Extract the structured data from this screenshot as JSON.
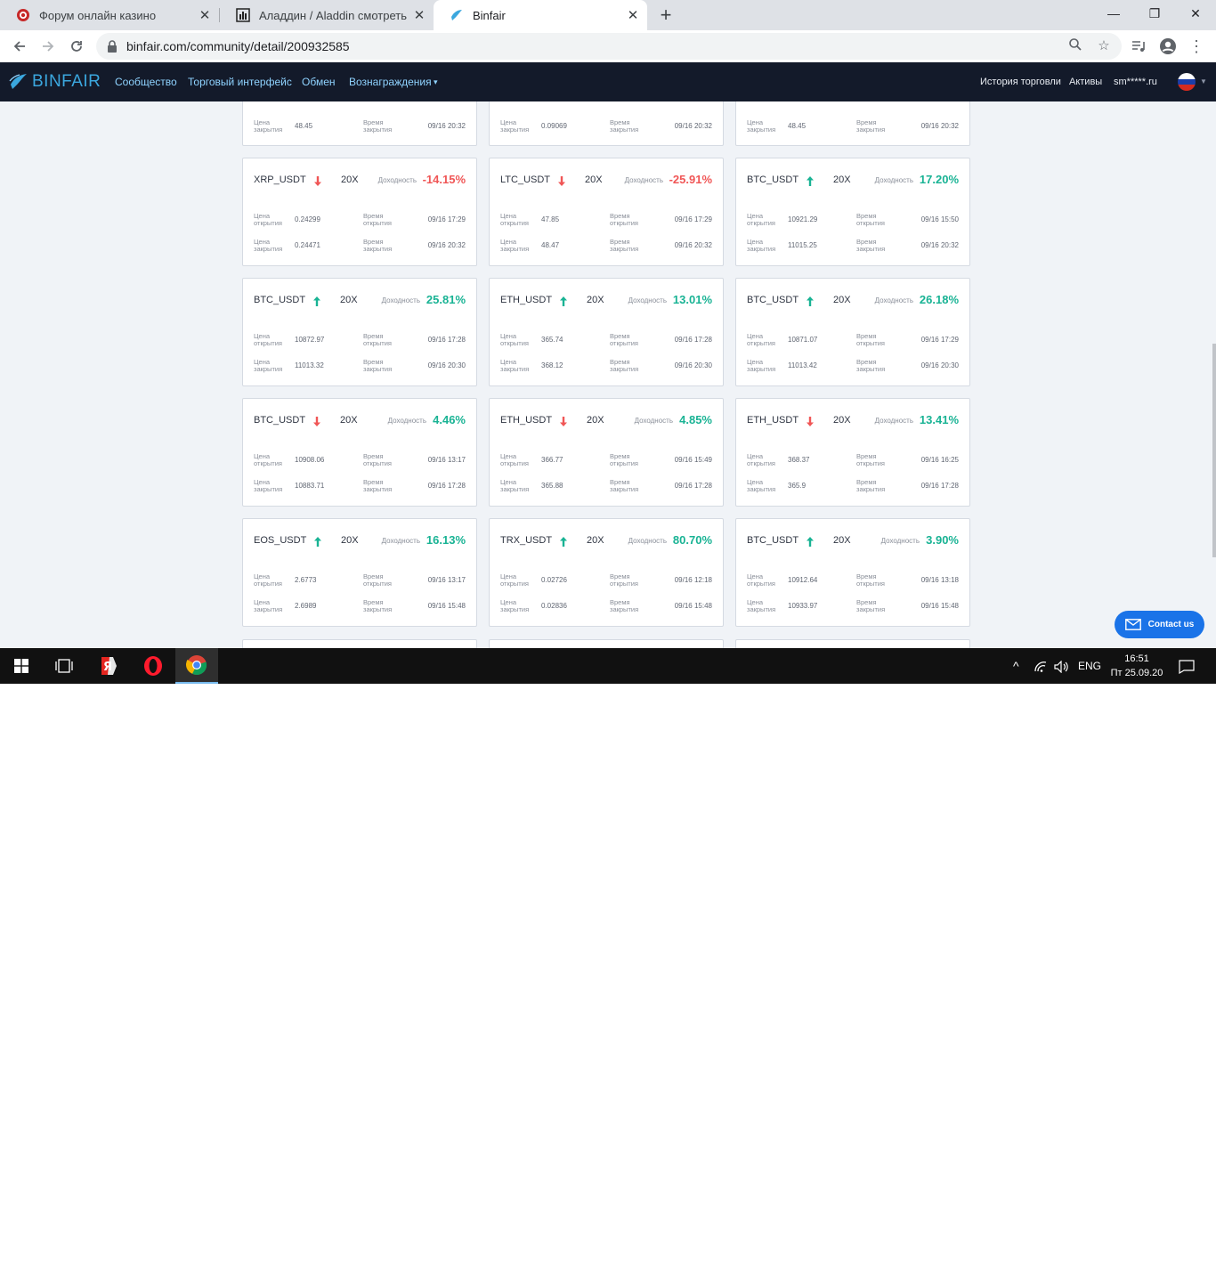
{
  "browser": {
    "tabs": [
      {
        "title": "Форум онлайн казино",
        "active": false,
        "favicon": "poker-chip-icon"
      },
      {
        "title": "Аладдин / Aladdin смотреть онлайн",
        "active": false,
        "favicon": "chart-bars-icon"
      },
      {
        "title": "Binfair",
        "active": true,
        "favicon": "binfair-icon"
      }
    ],
    "url": "binfair.com/community/detail/200932585"
  },
  "site": {
    "logo_text": "BINFAIR",
    "nav": [
      {
        "label": "Сообщество"
      },
      {
        "label": "Торговый интерфейс"
      },
      {
        "label": "Обмен"
      },
      {
        "label": "Вознаграждения"
      }
    ],
    "nav_caret": "▾",
    "right_nav": [
      {
        "label": "История торговли"
      },
      {
        "label": "Активы"
      },
      {
        "label": "sm*****.ru"
      }
    ]
  },
  "labels": {
    "yield": "Доходность",
    "open_price": "Цена открытия",
    "open_time": "Время открытия",
    "close_price": "Цена закрытия",
    "close_time": "Время закрытия"
  },
  "partial_row": [
    {
      "close_price": "48.45",
      "close_time": "09/16 20:32"
    },
    {
      "close_price": "0.09069",
      "close_time": "09/16 20:32"
    },
    {
      "close_price": "48.45",
      "close_time": "09/16 20:32"
    }
  ],
  "cards": [
    {
      "pair": "XRP_USDT",
      "dir": "down",
      "leverage": "20X",
      "yield": "-14.15%",
      "open_price": "0.24299",
      "open_time": "09/16 17:29",
      "close_price": "0.24471",
      "close_time": "09/16 20:32"
    },
    {
      "pair": "LTC_USDT",
      "dir": "down",
      "leverage": "20X",
      "yield": "-25.91%",
      "open_price": "47.85",
      "open_time": "09/16 17:29",
      "close_price": "48.47",
      "close_time": "09/16 20:32"
    },
    {
      "pair": "BTC_USDT",
      "dir": "up",
      "leverage": "20X",
      "yield": "17.20%",
      "open_price": "10921.29",
      "open_time": "09/16 15:50",
      "close_price": "11015.25",
      "close_time": "09/16 20:32"
    },
    {
      "pair": "BTC_USDT",
      "dir": "up",
      "leverage": "20X",
      "yield": "25.81%",
      "open_price": "10872.97",
      "open_time": "09/16 17:28",
      "close_price": "11013.32",
      "close_time": "09/16 20:30"
    },
    {
      "pair": "ETH_USDT",
      "dir": "up",
      "leverage": "20X",
      "yield": "13.01%",
      "open_price": "365.74",
      "open_time": "09/16 17:28",
      "close_price": "368.12",
      "close_time": "09/16 20:30"
    },
    {
      "pair": "BTC_USDT",
      "dir": "up",
      "leverage": "20X",
      "yield": "26.18%",
      "open_price": "10871.07",
      "open_time": "09/16 17:29",
      "close_price": "11013.42",
      "close_time": "09/16 20:30"
    },
    {
      "pair": "BTC_USDT",
      "dir": "down",
      "leverage": "20X",
      "yield": "4.46%",
      "open_price": "10908.06",
      "open_time": "09/16 13:17",
      "close_price": "10883.71",
      "close_time": "09/16 17:28"
    },
    {
      "pair": "ETH_USDT",
      "dir": "down",
      "leverage": "20X",
      "yield": "4.85%",
      "open_price": "366.77",
      "open_time": "09/16 15:49",
      "close_price": "365.88",
      "close_time": "09/16 17:28"
    },
    {
      "pair": "ETH_USDT",
      "dir": "down",
      "leverage": "20X",
      "yield": "13.41%",
      "open_price": "368.37",
      "open_time": "09/16 16:25",
      "close_price": "365.9",
      "close_time": "09/16 17:28"
    },
    {
      "pair": "EOS_USDT",
      "dir": "up",
      "leverage": "20X",
      "yield": "16.13%",
      "open_price": "2.6773",
      "open_time": "09/16 13:17",
      "close_price": "2.6989",
      "close_time": "09/16 15:48"
    },
    {
      "pair": "TRX_USDT",
      "dir": "up",
      "leverage": "20X",
      "yield": "80.70%",
      "open_price": "0.02726",
      "open_time": "09/16 12:18",
      "close_price": "0.02836",
      "close_time": "09/16 15:48"
    },
    {
      "pair": "BTC_USDT",
      "dir": "up",
      "leverage": "20X",
      "yield": "3.90%",
      "open_price": "10912.64",
      "open_time": "09/16 13:18",
      "close_price": "10933.97",
      "close_time": "09/16 15:48"
    }
  ],
  "contact_button": "Contact us",
  "taskbar": {
    "lang": "ENG",
    "time": "16:51",
    "date": "Пт 25.09.20"
  },
  "colors": {
    "nav_bg": "#131a2a",
    "nav_link": "#8fd3ff",
    "up": "#19b394",
    "down": "#f05656",
    "contact_bg": "#1a73e8"
  }
}
